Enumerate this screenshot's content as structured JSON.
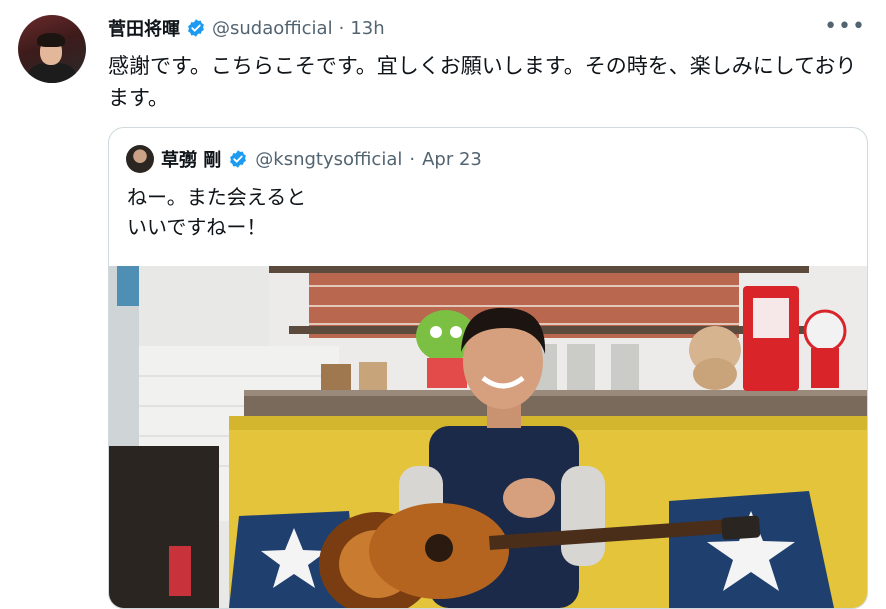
{
  "tweet": {
    "display_name": "菅田将暉",
    "handle": "@sudaofficial",
    "separator": "·",
    "time": "13h",
    "more_label": "•••",
    "text": "感謝です。こちらこそです。宜しくお願いします。その時を、楽しみにしております。",
    "verified": true
  },
  "quoted": {
    "display_name": "草彅 剛",
    "handle": "@ksngtysofficial",
    "separator": "·",
    "date": "Apr 23",
    "text_line1": "ねー。また会えると",
    "text_line2": "いいですねー！",
    "verified": true
  },
  "colors": {
    "verified_blue": "#1d9bf0",
    "secondary_text": "#536471",
    "border": "#cfd9de"
  },
  "media": {
    "description_icon": "video-thumbnail"
  }
}
